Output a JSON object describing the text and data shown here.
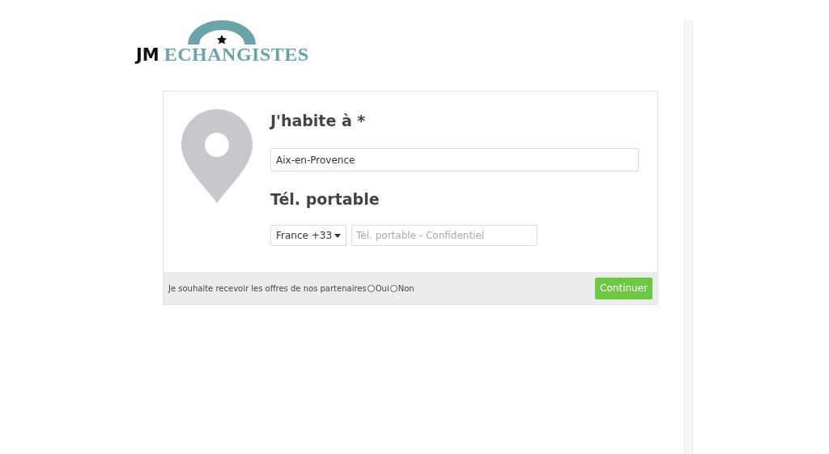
{
  "logo": {
    "part_1": "JM",
    "part_2": "ECHANGISTES"
  },
  "city": {
    "label": "J'habite à *",
    "value": "Aix-en-Provence"
  },
  "phone": {
    "label": "Tél. portable",
    "country": "France +33",
    "placeholder": "Tél. portable - Confidentiel"
  },
  "footer": {
    "question": "Je souhaite recevoir les offres de nos partenaires",
    "options": [
      {
        "label": "Oui",
        "selected": false
      },
      {
        "label": "Non",
        "selected": false
      }
    ],
    "button": "Continuer"
  }
}
